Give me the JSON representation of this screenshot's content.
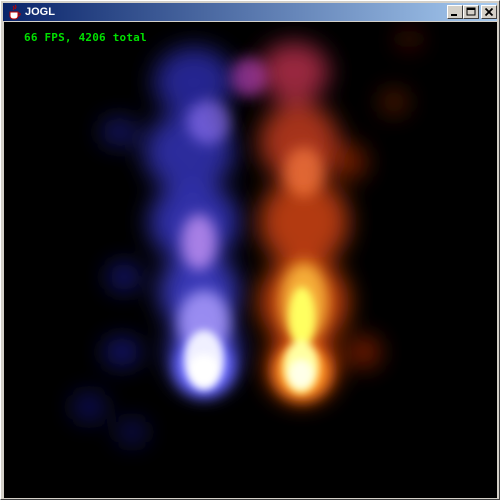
{
  "window": {
    "title": "JOGL",
    "icon": "java-cup-icon",
    "buttons": {
      "minimize": "minimize-icon",
      "maximize": "maximize-icon",
      "close": "close-icon"
    }
  },
  "canvas": {
    "background": "#000000",
    "fps_label": "66 FPS, 4206 total"
  },
  "colors": {
    "titlebar_start": "#0a246a",
    "titlebar_end": "#a6caf0",
    "fps_text": "#00e000",
    "blue_flame": "#4040ff",
    "orange_flame": "#ff5010"
  }
}
